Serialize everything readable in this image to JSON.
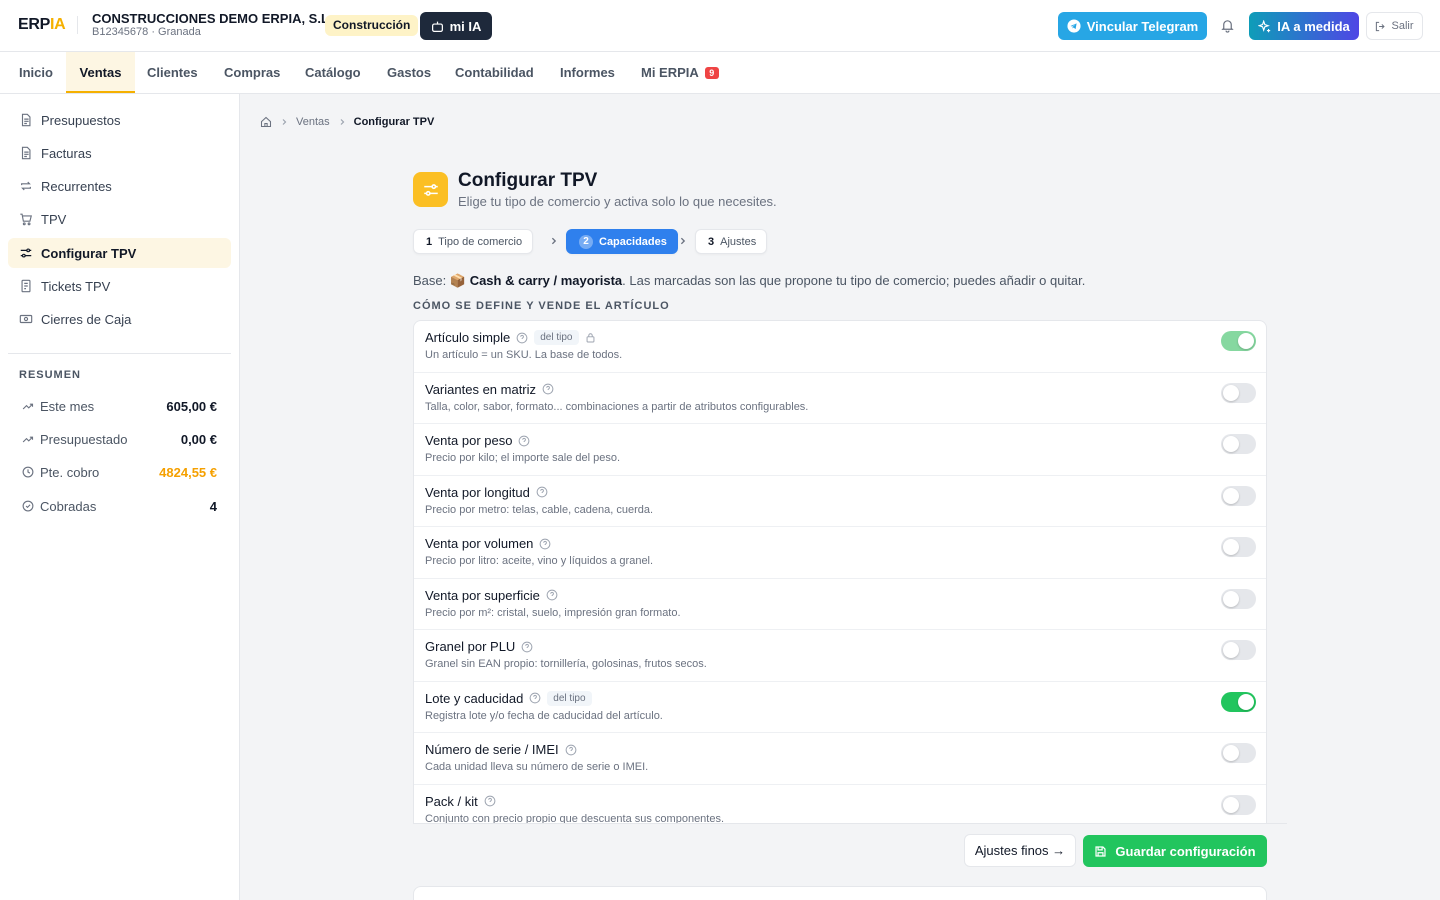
{
  "brand": {
    "logo_main": "ERP",
    "logo_accent": "IA"
  },
  "company": {
    "name": "CONSTRUCCIONES DEMO ERPIA, S.L.",
    "sub": "B12345678 · Granada",
    "sector": "Construcción"
  },
  "header": {
    "mi_ia": "mi IA",
    "telegram": "Vincular Telegram",
    "ia_medida": "IA a medida",
    "salir": "Salir"
  },
  "nav": {
    "items": [
      "Inicio",
      "Ventas",
      "Clientes",
      "Compras",
      "Catálogo",
      "Gastos",
      "Contabilidad",
      "Informes",
      "Mi ERPIA"
    ],
    "active": "Ventas",
    "mi_erpia_badge": "9"
  },
  "sidebar": {
    "items": [
      {
        "label": "Presupuestos",
        "icon": "document-icon"
      },
      {
        "label": "Facturas",
        "icon": "document-icon"
      },
      {
        "label": "Recurrentes",
        "icon": "repeat-icon"
      },
      {
        "label": "TPV",
        "icon": "cart-icon"
      },
      {
        "label": "Configurar TPV",
        "icon": "sliders-icon",
        "active": true
      },
      {
        "label": "Tickets TPV",
        "icon": "receipt-icon"
      },
      {
        "label": "Cierres de Caja",
        "icon": "cash-icon"
      }
    ],
    "resumen_title": "RESUMEN",
    "resumen": [
      {
        "label": "Este mes",
        "value": "605,00 €",
        "icon": "trend-up-icon"
      },
      {
        "label": "Presupuestado",
        "value": "0,00 €",
        "icon": "trend-up-icon"
      },
      {
        "label": "Pte. cobro",
        "value": "4824,55 €",
        "icon": "clock-icon",
        "accent": "#f5a000"
      },
      {
        "label": "Cobradas",
        "value": "4",
        "icon": "check-circle-icon"
      }
    ]
  },
  "breadcrumb": {
    "section": "Ventas",
    "current": "Configurar TPV"
  },
  "page": {
    "title": "Configurar TPV",
    "subtitle": "Elige tu tipo de comercio y activa solo lo que necesites."
  },
  "steps": [
    {
      "num": "1",
      "label": "Tipo de comercio"
    },
    {
      "num": "2",
      "label": "Capacidades",
      "active": true
    },
    {
      "num": "3",
      "label": "Ajustes"
    }
  ],
  "base": {
    "prefix": "Base:",
    "emoji": "📦",
    "name": "Cash & carry / mayorista",
    "suffix": ". Las marcadas son las que propone tu tipo de comercio; puedes añadir o quitar."
  },
  "section_title": "CÓMO SE DEFINE Y VENDE EL ARTÍCULO",
  "tag_label": "del tipo",
  "capabilities": [
    {
      "title": "Artículo simple",
      "desc": "Un artículo = un SKU. La base de todos.",
      "tag": true,
      "locked": true,
      "on": true
    },
    {
      "title": "Variantes en matriz",
      "desc": "Talla, color, sabor, formato... combinaciones a partir de atributos configurables.",
      "on": false
    },
    {
      "title": "Venta por peso",
      "desc": "Precio por kilo; el importe sale del peso.",
      "on": false
    },
    {
      "title": "Venta por longitud",
      "desc": "Precio por metro: telas, cable, cadena, cuerda.",
      "on": false
    },
    {
      "title": "Venta por volumen",
      "desc": "Precio por litro: aceite, vino y líquidos a granel.",
      "on": false
    },
    {
      "title": "Venta por superficie",
      "desc": "Precio por m²: cristal, suelo, impresión gran formato.",
      "on": false
    },
    {
      "title": "Granel por PLU",
      "desc": "Granel sin EAN propio: tornillería, golosinas, frutos secos.",
      "on": false
    },
    {
      "title": "Lote y caducidad",
      "desc": "Registra lote y/o fecha de caducidad del artículo.",
      "tag": true,
      "on": true
    },
    {
      "title": "Número de serie / IMEI",
      "desc": "Cada unidad lleva su número de serie o IMEI.",
      "on": false
    },
    {
      "title": "Pack / kit",
      "desc": "Conjunto con precio propio que descuenta sus componentes.",
      "on": false
    }
  ],
  "footer": {
    "fine": "Ajustes finos →",
    "save": "Guardar configuración"
  },
  "colors": {
    "accent": "#f5b000",
    "primary": "#2f80ed",
    "success": "#22c55e",
    "telegram": "#27a6e5"
  }
}
